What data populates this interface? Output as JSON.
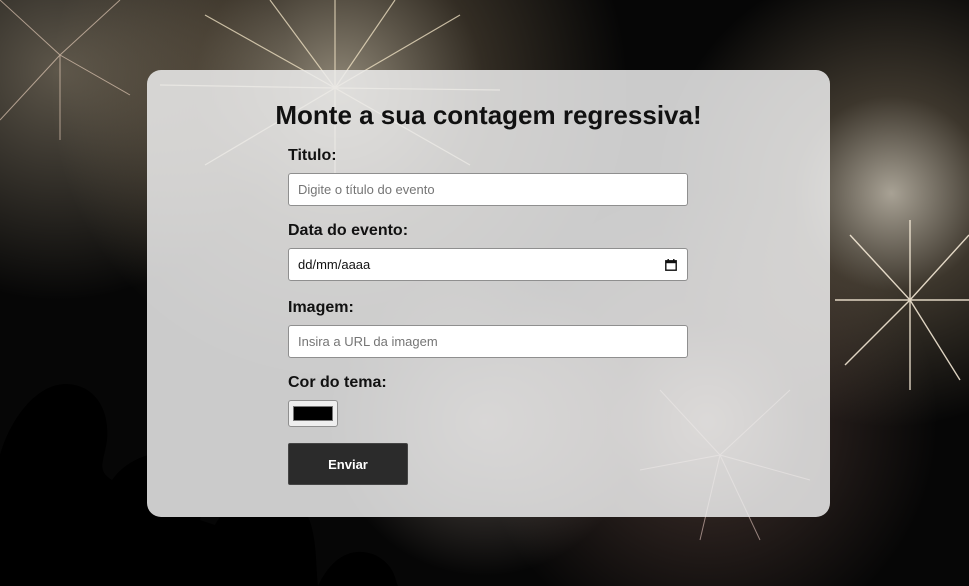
{
  "page": {
    "heading": "Monte a sua contagem regressiva!"
  },
  "form": {
    "title": {
      "label": "Titulo:",
      "placeholder": "Digite o título do evento"
    },
    "date": {
      "label": "Data do evento:",
      "value": "dd/mm/aaaa",
      "icon": "calendar-icon"
    },
    "image": {
      "label": "Imagem:",
      "placeholder": "Insira a URL da imagem"
    },
    "theme_color": {
      "label": "Cor do tema:",
      "value": "#000000"
    },
    "submit_label": "Enviar"
  },
  "colors": {
    "card_background": "#ececec",
    "button_background": "#2b2b2b",
    "button_text": "#ffffff"
  }
}
